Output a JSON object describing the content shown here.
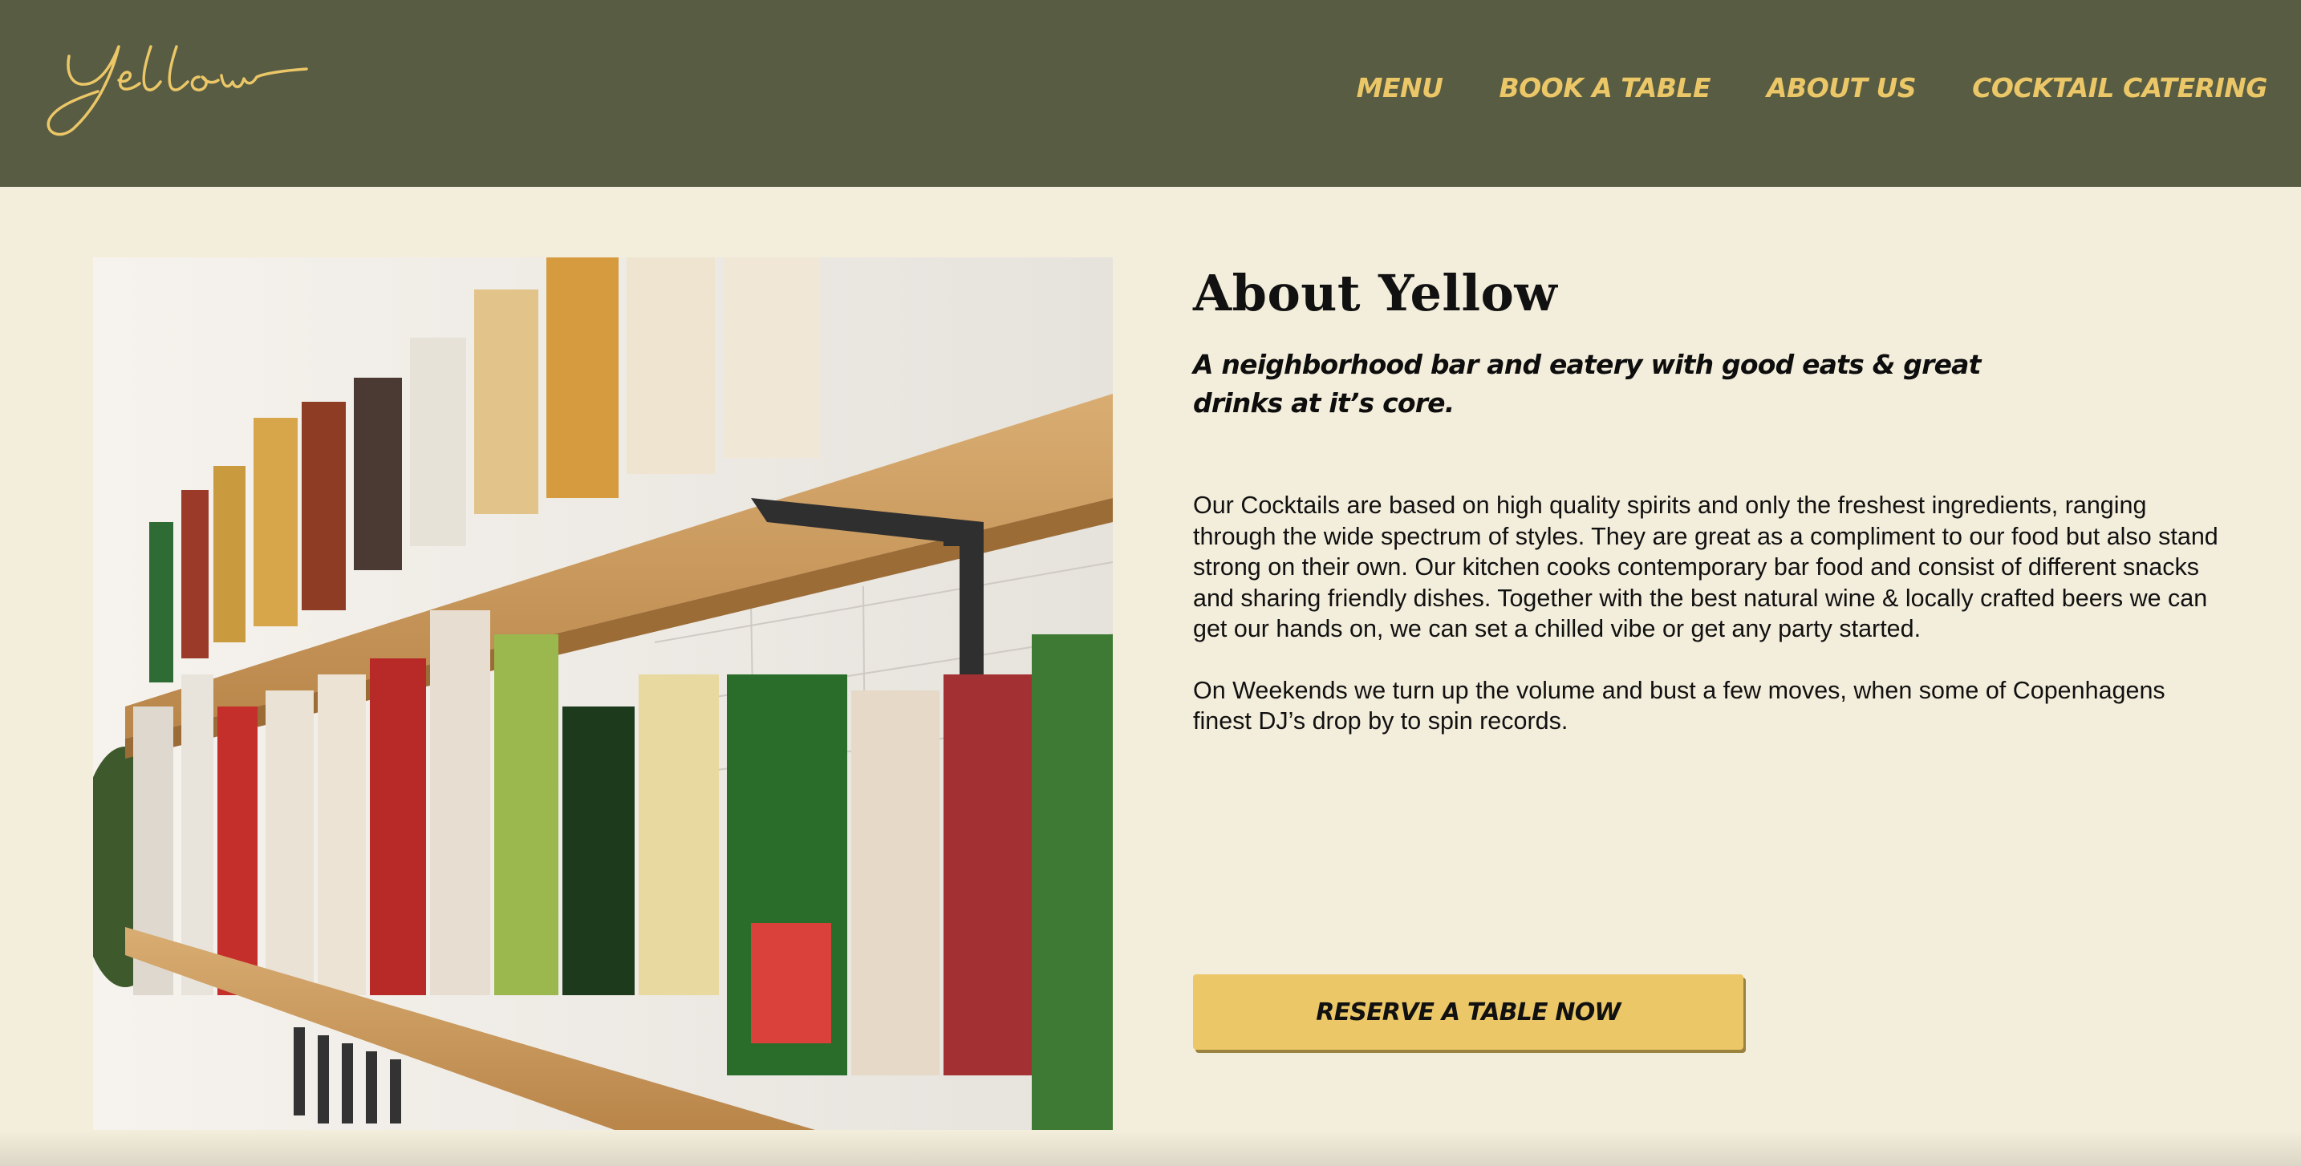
{
  "header": {
    "logo_text": "Yellow",
    "nav": [
      {
        "label": "MENU"
      },
      {
        "label": "BOOK A TABLE"
      },
      {
        "label": "ABOUT US"
      },
      {
        "label": "COCKTAIL CATERING"
      }
    ]
  },
  "about": {
    "title": "About Yellow",
    "tagline": "A neighborhood bar and eatery with good eats & great drinks at it’s core.",
    "paragraph1": "Our Cocktails are based on high quality spirits and only the freshest ingredients, ranging through the wide spectrum of styles. They are great as a compliment to our food but also stand strong on their own. Our kitchen cooks contemporary bar food and consist of different snacks and sharing friendly dishes. Together with the best natural wine & locally crafted beers we can get our hands on, we can set a chilled vibe or get any party started.",
    "paragraph2": "On Weekends we turn up the volume and bust a few moves, when some of Copenhagens finest DJ’s drop by to spin records.",
    "cta_label": "RESERVE A TABLE NOW"
  },
  "colors": {
    "header_bg": "#585c43",
    "accent_yellow": "#ecc767",
    "page_bg": "#f3eddb",
    "text": "#111111"
  }
}
